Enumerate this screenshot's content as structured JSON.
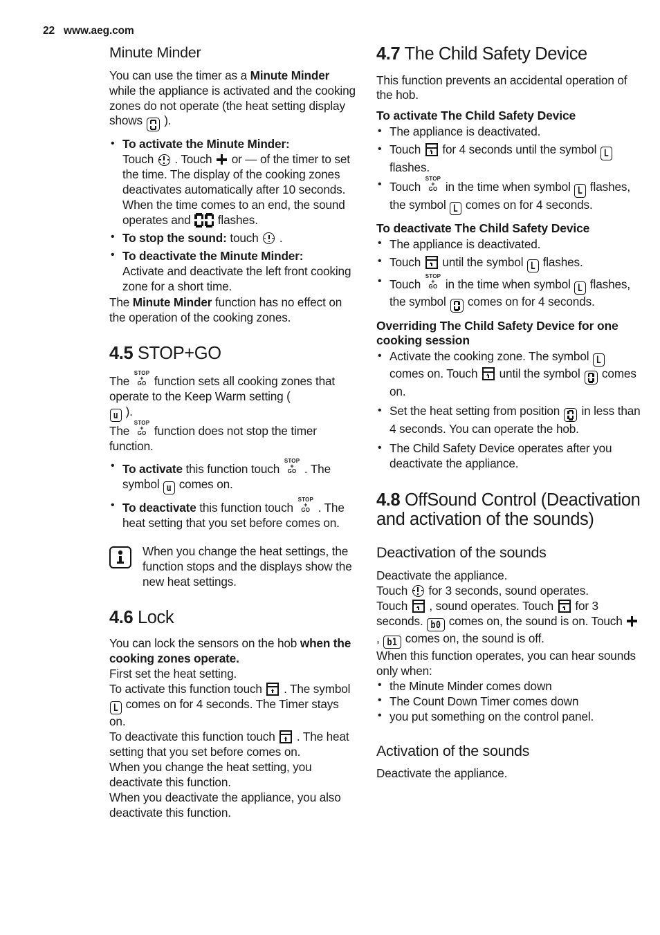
{
  "header": {
    "page_number": "22",
    "website": "www.aeg.com"
  },
  "left_column": {
    "minute_minder": {
      "title": "Minute Minder",
      "intro_a": "You can use the timer as a ",
      "intro_b": "Minute Minder",
      "intro_c": " while the appliance is activated and the cooking zones do not operate (the heat setting display shows ",
      "intro_d": " ).",
      "bullets": [
        {
          "bold": "To activate the Minute Minder:",
          "text_a": "Touch ",
          "text_b": " . Touch ",
          "text_c": " or — of the timer to set the time. The display of the cooking zones deactivates automatically after 10 seconds. When the time comes to an end, the sound operates and ",
          "text_d": " flashes."
        },
        {
          "bold": "To stop the sound:",
          "text_a": " touch ",
          "text_b": " ."
        },
        {
          "bold": "To deactivate the Minute Minder:",
          "text_a": " Activate and deactivate the left front cooking zone for a short time."
        }
      ],
      "closing_a": "The ",
      "closing_b": "Minute Minder",
      "closing_c": " function has no effect on the operation of the cooking zones."
    },
    "stop_go": {
      "number": "4.5",
      "title": "STOP+GO",
      "p1_a": "The ",
      "p1_b": " function sets all cooking zones that operate to the Keep Warm setting ( ",
      "p1_c": " ).",
      "p2_a": "The ",
      "p2_b": " function does not stop the timer function.",
      "bullets": [
        {
          "bold": "To activate",
          "text_a": " this function touch ",
          "text_b": " . The symbol ",
          "text_c": " comes on."
        },
        {
          "bold": "To deactivate",
          "text_a": " this function touch ",
          "text_b": " . The heat setting that you set before comes on."
        }
      ],
      "note": "When you change the heat settings, the function stops and the displays show the new heat settings."
    },
    "lock": {
      "number": "4.6",
      "title": "Lock",
      "p1_a": "You can lock the sensors on the hob ",
      "p1_b": "when the cooking zones operate.",
      "p1_c": " First set the heat setting.",
      "p2_a": "To activate this function touch ",
      "p2_b": " . The symbol ",
      "p2_c": " comes on for 4 seconds. The Timer stays on.",
      "p3_a": "To deactivate this function touch ",
      "p3_b": " . The heat setting that you set before comes on.",
      "p4": "When you change the heat setting, you deactivate this function.",
      "p5": "When you deactivate the appliance, you also deactivate this function."
    }
  },
  "right_column": {
    "child_safety": {
      "number": "4.7",
      "title": "The Child Safety Device",
      "intro": "This function prevents an accidental operation of the hob.",
      "activate_heading": "To activate The Child Safety Device",
      "activate_bullets": [
        {
          "text_a": "The appliance is deactivated."
        },
        {
          "text_a": "Touch ",
          "text_b": " for 4 seconds until the symbol ",
          "text_c": " flashes."
        },
        {
          "text_a": "Touch ",
          "text_b": " in the time when symbol ",
          "text_c": " flashes, the symbol ",
          "text_d": " comes on for 4 seconds."
        }
      ],
      "deactivate_heading": "To deactivate The Child Safety Device",
      "deactivate_bullets": [
        {
          "text_a": "The appliance is deactivated."
        },
        {
          "text_a": "Touch ",
          "text_b": " until the symbol ",
          "text_c": " flashes."
        },
        {
          "text_a": "Touch ",
          "text_b": " in the time when symbol ",
          "text_c": " flashes, the symbol ",
          "text_d": " comes on for 4 seconds."
        }
      ],
      "override_heading": "Overriding The Child Safety Device for one cooking session",
      "override_bullets": [
        {
          "text_a": "Activate the cooking zone. The symbol ",
          "text_b": " comes on. Touch ",
          "text_c": " until the symbol ",
          "text_d": " comes on."
        },
        {
          "text_a": "Set the heat setting from position ",
          "text_b": " in less than 4 seconds. You can operate the hob."
        },
        {
          "text_a": "The Child Safety Device operates after you deactivate the appliance."
        }
      ]
    },
    "offsound": {
      "number": "4.8",
      "title": "OffSound Control (Deactivation and activation of the sounds)",
      "deactivation_heading": "Deactivation of the sounds",
      "d_p1": "Deactivate the appliance.",
      "d_p2_a": "Touch ",
      "d_p2_b": " for 3 seconds, sound operates.",
      "d_p3_a": "Touch ",
      "d_p3_b": " , sound operates. Touch ",
      "d_p3_c": " for 3 seconds. ",
      "d_p3_d": " comes on, the sound is on. Touch ",
      "d_p3_e": " , ",
      "d_p3_f": " comes on, the sound is off.",
      "d_p4": "When this function operates, you can hear sounds only when:",
      "d_bullets": [
        "the Minute Minder comes down",
        "The Count Down Timer comes down",
        "you put something on the control panel."
      ],
      "activation_heading": "Activation of the sounds",
      "a_p1": "Deactivate the appliance."
    }
  },
  "symbols": {
    "zero": "0",
    "double_zero": "00",
    "letter_l": "L",
    "letter_u": "u",
    "b_zero": "b0",
    "b_one": "b1",
    "stop": "STOP",
    "plus": "+",
    "go": "GO"
  }
}
